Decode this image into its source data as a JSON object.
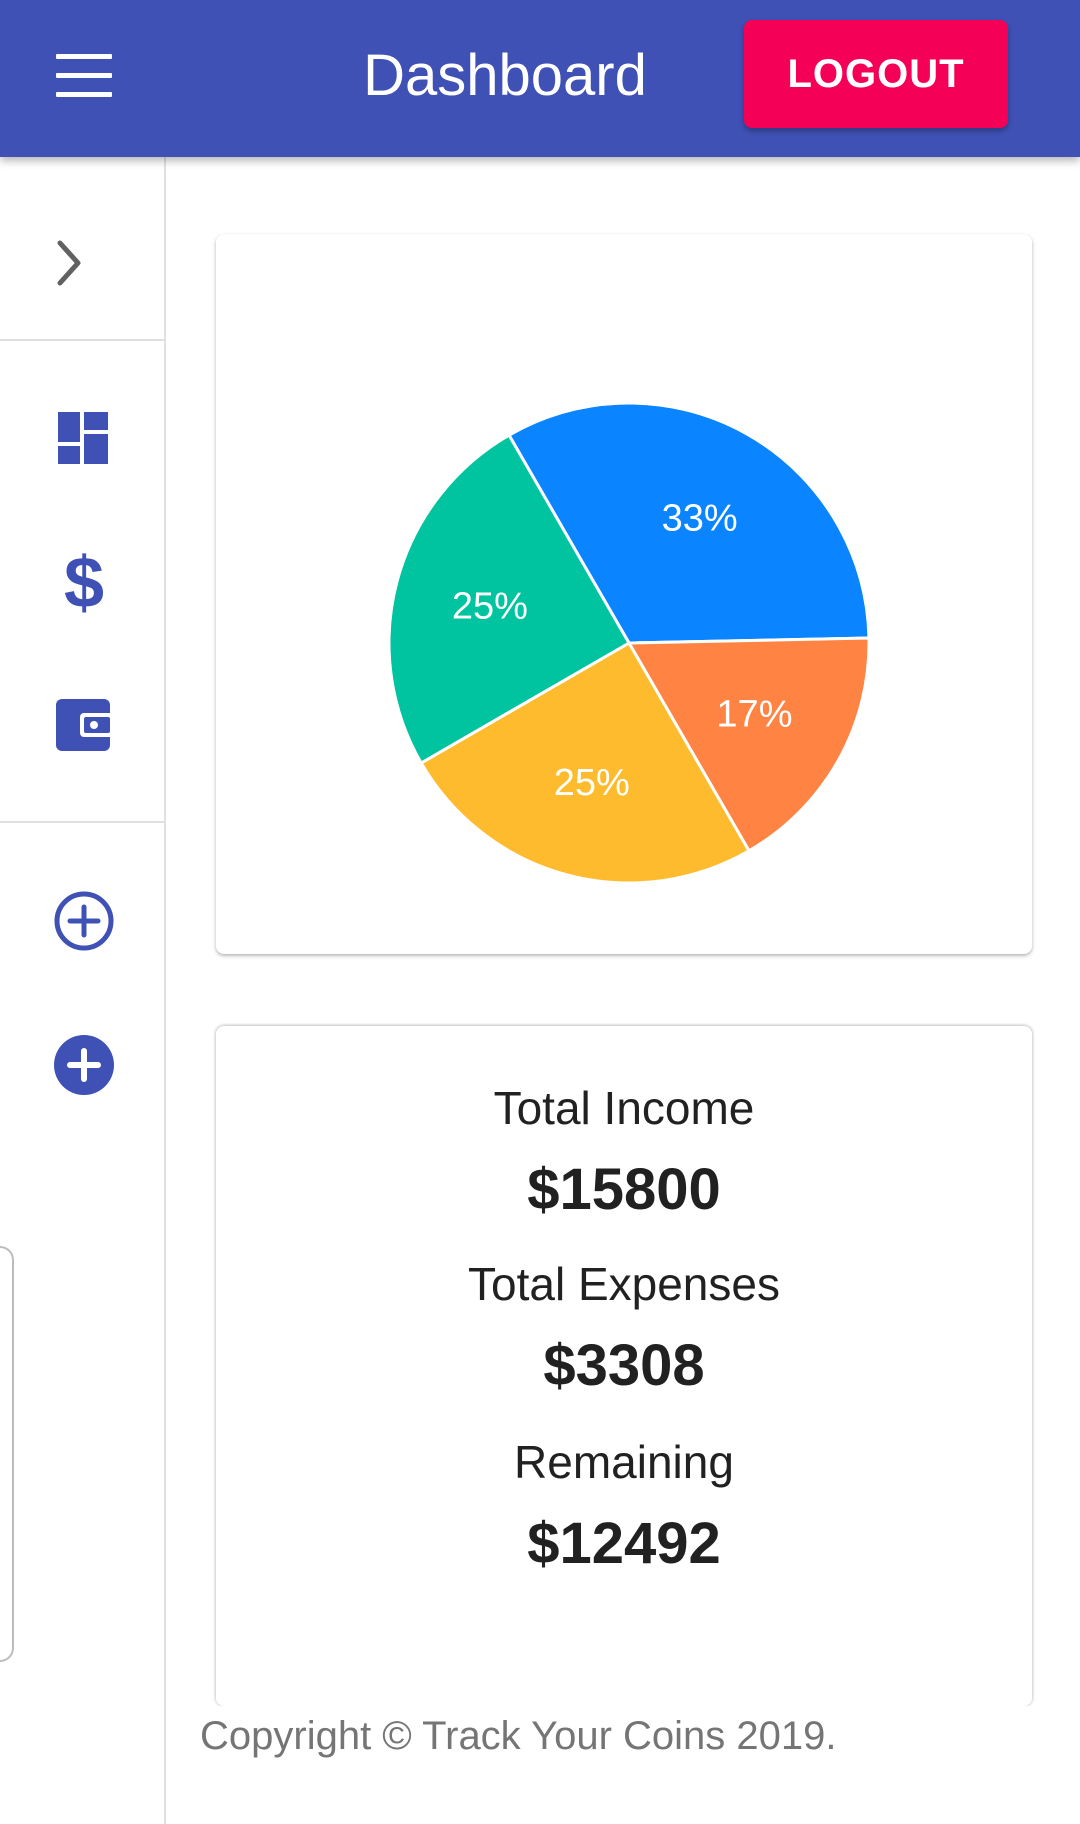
{
  "appbar": {
    "title": "Dashboard",
    "logout_label": "LOGOUT",
    "color": "#3f51b5",
    "logout_color": "#f50057"
  },
  "drawer": {
    "toggle_icon": "chevron-right-icon",
    "items": [
      {
        "icon": "dashboard-icon"
      },
      {
        "icon": "dollar-icon",
        "glyph": "$"
      },
      {
        "icon": "wallet-icon"
      },
      {
        "icon": "add-circle-outline-icon"
      },
      {
        "icon": "add-circle-filled-icon"
      }
    ],
    "icon_color": "#3f51b5"
  },
  "chart_data": {
    "type": "pie",
    "slices": [
      {
        "label": "33%",
        "value": 33,
        "color": "#0a84ff"
      },
      {
        "label": "17%",
        "value": 17,
        "color": "#ff8444"
      },
      {
        "label": "25%",
        "value": 25,
        "color": "#fdbb2d"
      },
      {
        "label": "25%",
        "value": 25,
        "color": "#00c49f"
      }
    ]
  },
  "summary": {
    "income_label": "Total Income",
    "income_value": "$15800",
    "expenses_label": "Total Expenses",
    "expenses_value": "$3308",
    "remaining_label": "Remaining",
    "remaining_value": "$12492"
  },
  "footer": {
    "text": "Copyright © Track Your Coins 2019."
  }
}
